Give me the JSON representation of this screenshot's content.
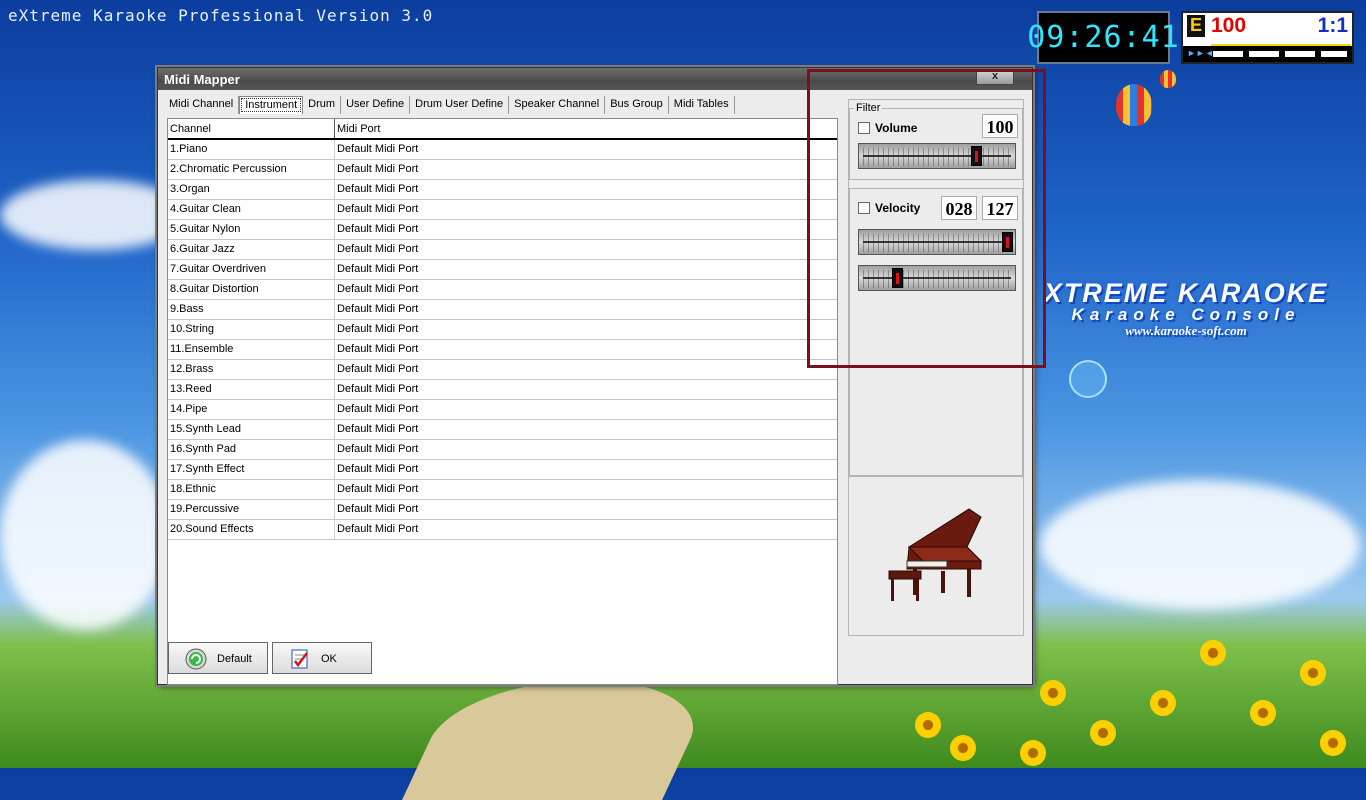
{
  "app": {
    "title": "eXtreme Karaoke Professional Version 3.0"
  },
  "clock": {
    "time": "09:26:41"
  },
  "score": {
    "badge": "E",
    "value": "100",
    "ratio": "1:1"
  },
  "branding": {
    "line1": "XTREME KARAOKE",
    "line2": "Karaoke Console",
    "line3": "www.karaoke-soft.com"
  },
  "dialog": {
    "title": "Midi Mapper",
    "close_label": "x",
    "tabs": [
      {
        "label": "Midi Channel",
        "active": false
      },
      {
        "label": "Instrument",
        "active": true
      },
      {
        "label": "Drum",
        "active": false
      },
      {
        "label": "User Define",
        "active": false
      },
      {
        "label": "Drum User Define",
        "active": false
      },
      {
        "label": "Speaker Channel",
        "active": false
      },
      {
        "label": "Bus Group",
        "active": false
      },
      {
        "label": "Midi Tables",
        "active": false
      }
    ],
    "table": {
      "headers": [
        "Channel",
        "Midi Port"
      ],
      "rows": [
        [
          "1.Piano",
          "Default Midi Port"
        ],
        [
          "2.Chromatic Percussion",
          "Default Midi Port"
        ],
        [
          "3.Organ",
          "Default Midi Port"
        ],
        [
          "4.Guitar Clean",
          "Default Midi Port"
        ],
        [
          "5.Guitar Nylon",
          "Default Midi Port"
        ],
        [
          "6.Guitar Jazz",
          "Default Midi Port"
        ],
        [
          "7.Guitar Overdriven",
          "Default Midi Port"
        ],
        [
          "8.Guitar Distortion",
          "Default Midi Port"
        ],
        [
          "9.Bass",
          "Default Midi Port"
        ],
        [
          "10.String",
          "Default Midi Port"
        ],
        [
          "11.Ensemble",
          "Default Midi Port"
        ],
        [
          "12.Brass",
          "Default Midi Port"
        ],
        [
          "13.Reed",
          "Default Midi Port"
        ],
        [
          "14.Pipe",
          "Default Midi Port"
        ],
        [
          "15.Synth Lead",
          "Default Midi Port"
        ],
        [
          "16.Synth Pad",
          "Default Midi Port"
        ],
        [
          "17.Synth Effect",
          "Default Midi Port"
        ],
        [
          "18.Ethnic",
          "Default Midi Port"
        ],
        [
          "19.Percussive",
          "Default Midi Port"
        ],
        [
          "20.Sound Effects",
          "Default Midi Port"
        ]
      ]
    },
    "filter": {
      "label": "Filter",
      "volume": {
        "label": "Volume",
        "value": "100",
        "checked": false,
        "level": 0.78
      },
      "velocity": {
        "label": "Velocity",
        "min": "028",
        "max": "127",
        "checked": false,
        "max_level": 1.0,
        "min_level": 0.22
      }
    },
    "buttons": {
      "default_label": "Default",
      "ok_label": "OK"
    }
  }
}
